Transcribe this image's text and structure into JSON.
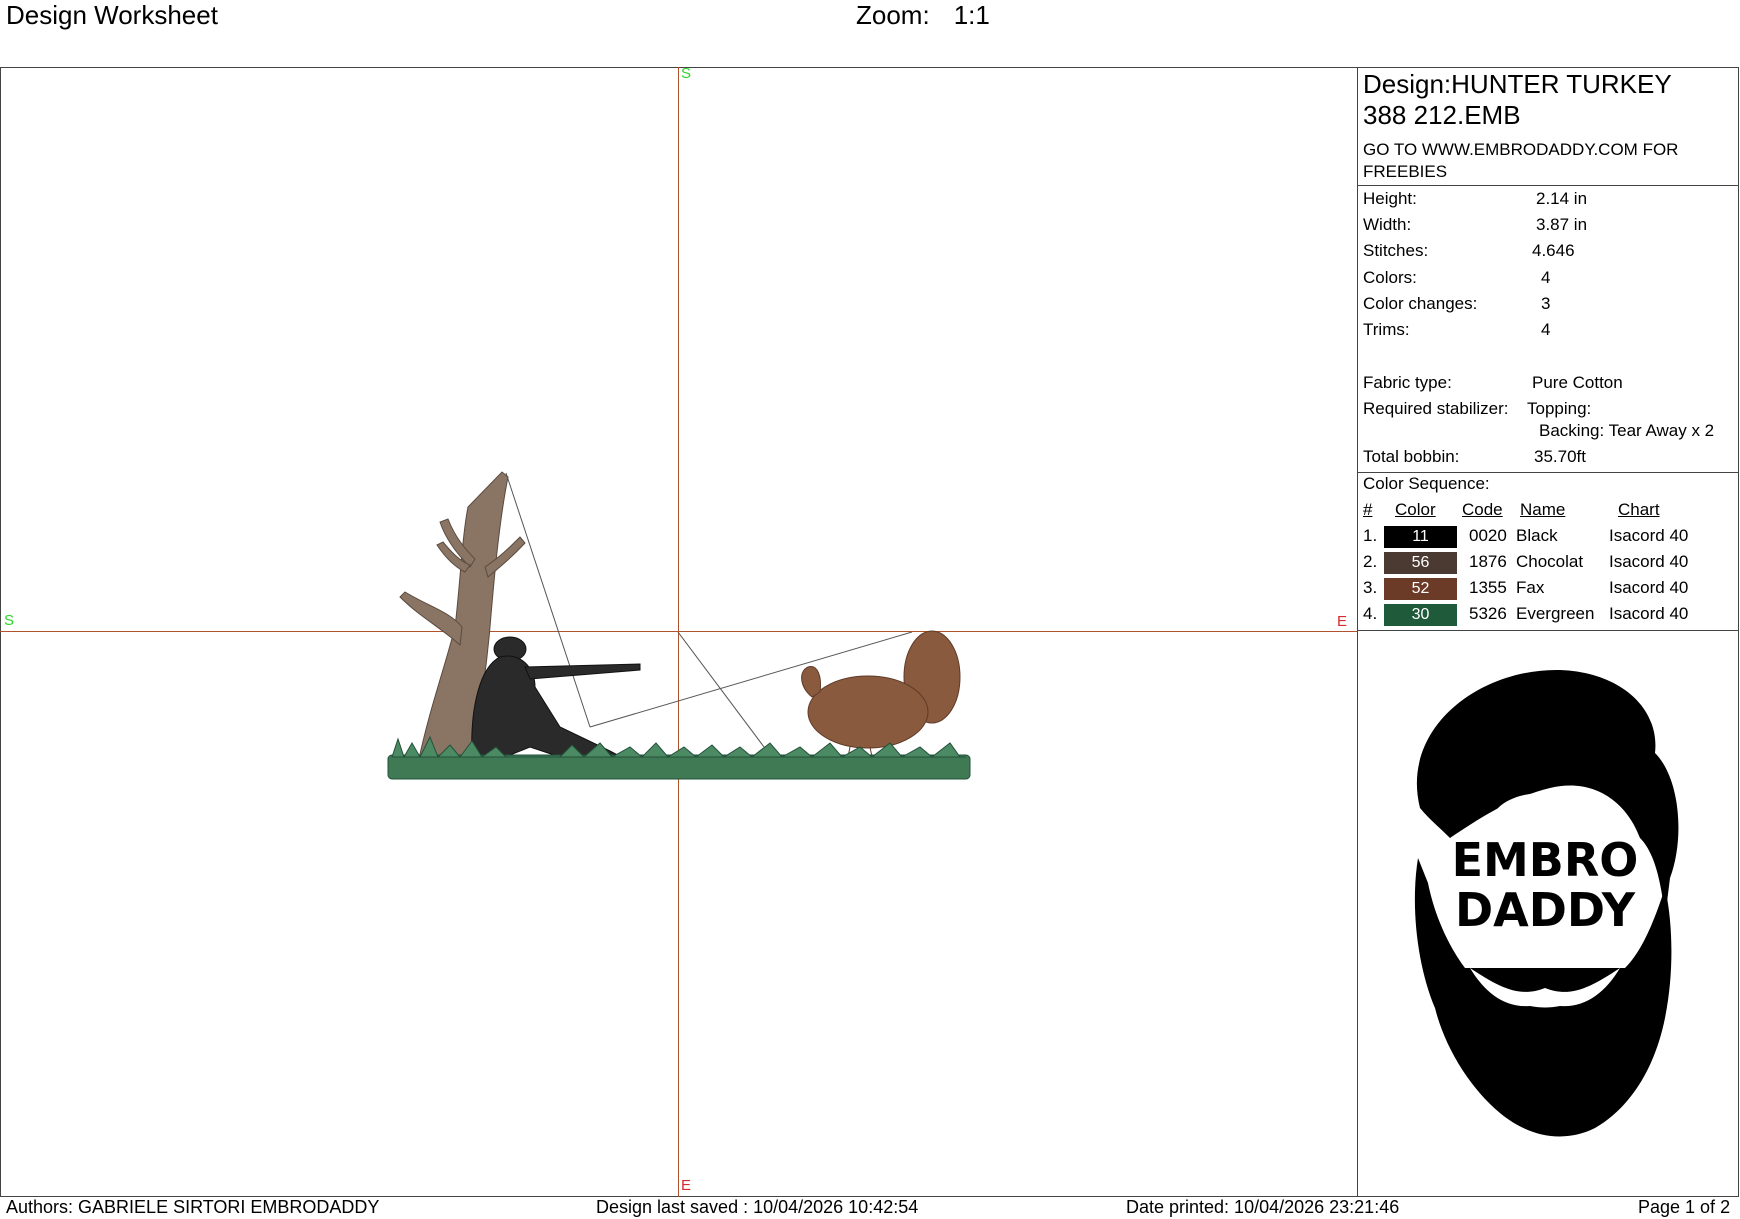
{
  "header": {
    "title": "Design Worksheet",
    "zoom_label": "Zoom:",
    "zoom_value": "1:1"
  },
  "canvas_markers": {
    "top": "S",
    "left": "S",
    "right": "E",
    "bottom": "E"
  },
  "design": {
    "name_line1": "Design:HUNTER TURKEY",
    "name_line2": "388 212.EMB",
    "promo": "GO TO WWW.EMBRODADDY.COM FOR FREEBIES"
  },
  "specs": [
    {
      "label": "Height:",
      "value": "2.14 in"
    },
    {
      "label": "Width:",
      "value": "3.87 in"
    },
    {
      "label": "Stitches:",
      "value": "4.646"
    },
    {
      "label": "Colors:",
      "value": "4"
    },
    {
      "label": "Color changes:",
      "value": "3"
    },
    {
      "label": "Trims:",
      "value": "4"
    }
  ],
  "fabric": {
    "label": "Fabric type:",
    "value": "Pure Cotton"
  },
  "stabilizer": {
    "label": "Required stabilizer:",
    "topping": "Topping:",
    "backing": "Backing: Tear Away x 2"
  },
  "bobbin": {
    "label": "Total bobbin:",
    "value": "35.70ft"
  },
  "color_sequence": {
    "title": "Color Sequence:",
    "headers": {
      "num": "#",
      "color": "Color",
      "code": "Code",
      "name": "Name",
      "chart": "Chart"
    },
    "rows": [
      {
        "num": "1.",
        "swatch": "11",
        "hex": "#000000",
        "code": "0020",
        "name": "Black",
        "chart": "Isacord 40"
      },
      {
        "num": "2.",
        "swatch": "56",
        "hex": "#4a3a31",
        "code": "1876",
        "name": "Chocolat",
        "chart": "Isacord 40"
      },
      {
        "num": "3.",
        "swatch": "52",
        "hex": "#6b3b28",
        "code": "1355",
        "name": "Fax",
        "chart": "Isacord 40"
      },
      {
        "num": "4.",
        "swatch": "30",
        "hex": "#1f5a3b",
        "code": "5326",
        "name": "Evergreen",
        "chart": "Isacord 40"
      }
    ]
  },
  "logo": {
    "line1": "EMBRO",
    "line2": "DADDY"
  },
  "footer": {
    "authors": "Authors: GABRIELE SIRTORI EMBRODADDY",
    "saved": "Design last saved : 10/04/2026 10:42:54",
    "printed": "Date printed: 10/04/2026 23:21:46",
    "page": "Page 1 of 2"
  },
  "colors": {
    "axis": "#b0522b",
    "marker_s": "#2bd62b",
    "marker_e": "#d62b2b",
    "grass": "#3f7a55",
    "tree": "#7a6656",
    "turkey": "#8a5a3e"
  }
}
